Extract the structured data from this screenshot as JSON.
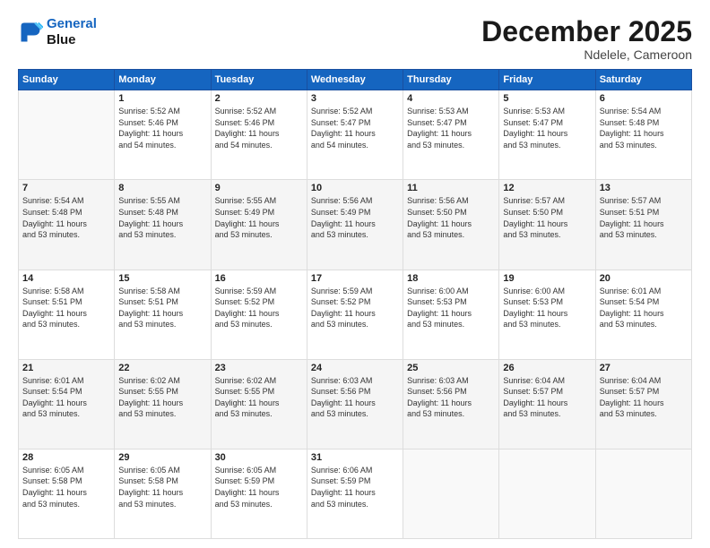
{
  "logo": {
    "line1": "General",
    "line2": "Blue"
  },
  "header": {
    "title": "December 2025",
    "subtitle": "Ndelele, Cameroon"
  },
  "weekdays": [
    "Sunday",
    "Monday",
    "Tuesday",
    "Wednesday",
    "Thursday",
    "Friday",
    "Saturday"
  ],
  "weeks": [
    [
      {
        "day": "",
        "info": ""
      },
      {
        "day": "1",
        "info": "Sunrise: 5:52 AM\nSunset: 5:46 PM\nDaylight: 11 hours\nand 54 minutes."
      },
      {
        "day": "2",
        "info": "Sunrise: 5:52 AM\nSunset: 5:46 PM\nDaylight: 11 hours\nand 54 minutes."
      },
      {
        "day": "3",
        "info": "Sunrise: 5:52 AM\nSunset: 5:47 PM\nDaylight: 11 hours\nand 54 minutes."
      },
      {
        "day": "4",
        "info": "Sunrise: 5:53 AM\nSunset: 5:47 PM\nDaylight: 11 hours\nand 53 minutes."
      },
      {
        "day": "5",
        "info": "Sunrise: 5:53 AM\nSunset: 5:47 PM\nDaylight: 11 hours\nand 53 minutes."
      },
      {
        "day": "6",
        "info": "Sunrise: 5:54 AM\nSunset: 5:48 PM\nDaylight: 11 hours\nand 53 minutes."
      }
    ],
    [
      {
        "day": "7",
        "info": "Sunrise: 5:54 AM\nSunset: 5:48 PM\nDaylight: 11 hours\nand 53 minutes."
      },
      {
        "day": "8",
        "info": "Sunrise: 5:55 AM\nSunset: 5:48 PM\nDaylight: 11 hours\nand 53 minutes."
      },
      {
        "day": "9",
        "info": "Sunrise: 5:55 AM\nSunset: 5:49 PM\nDaylight: 11 hours\nand 53 minutes."
      },
      {
        "day": "10",
        "info": "Sunrise: 5:56 AM\nSunset: 5:49 PM\nDaylight: 11 hours\nand 53 minutes."
      },
      {
        "day": "11",
        "info": "Sunrise: 5:56 AM\nSunset: 5:50 PM\nDaylight: 11 hours\nand 53 minutes."
      },
      {
        "day": "12",
        "info": "Sunrise: 5:57 AM\nSunset: 5:50 PM\nDaylight: 11 hours\nand 53 minutes."
      },
      {
        "day": "13",
        "info": "Sunrise: 5:57 AM\nSunset: 5:51 PM\nDaylight: 11 hours\nand 53 minutes."
      }
    ],
    [
      {
        "day": "14",
        "info": "Sunrise: 5:58 AM\nSunset: 5:51 PM\nDaylight: 11 hours\nand 53 minutes."
      },
      {
        "day": "15",
        "info": "Sunrise: 5:58 AM\nSunset: 5:51 PM\nDaylight: 11 hours\nand 53 minutes."
      },
      {
        "day": "16",
        "info": "Sunrise: 5:59 AM\nSunset: 5:52 PM\nDaylight: 11 hours\nand 53 minutes."
      },
      {
        "day": "17",
        "info": "Sunrise: 5:59 AM\nSunset: 5:52 PM\nDaylight: 11 hours\nand 53 minutes."
      },
      {
        "day": "18",
        "info": "Sunrise: 6:00 AM\nSunset: 5:53 PM\nDaylight: 11 hours\nand 53 minutes."
      },
      {
        "day": "19",
        "info": "Sunrise: 6:00 AM\nSunset: 5:53 PM\nDaylight: 11 hours\nand 53 minutes."
      },
      {
        "day": "20",
        "info": "Sunrise: 6:01 AM\nSunset: 5:54 PM\nDaylight: 11 hours\nand 53 minutes."
      }
    ],
    [
      {
        "day": "21",
        "info": "Sunrise: 6:01 AM\nSunset: 5:54 PM\nDaylight: 11 hours\nand 53 minutes."
      },
      {
        "day": "22",
        "info": "Sunrise: 6:02 AM\nSunset: 5:55 PM\nDaylight: 11 hours\nand 53 minutes."
      },
      {
        "day": "23",
        "info": "Sunrise: 6:02 AM\nSunset: 5:55 PM\nDaylight: 11 hours\nand 53 minutes."
      },
      {
        "day": "24",
        "info": "Sunrise: 6:03 AM\nSunset: 5:56 PM\nDaylight: 11 hours\nand 53 minutes."
      },
      {
        "day": "25",
        "info": "Sunrise: 6:03 AM\nSunset: 5:56 PM\nDaylight: 11 hours\nand 53 minutes."
      },
      {
        "day": "26",
        "info": "Sunrise: 6:04 AM\nSunset: 5:57 PM\nDaylight: 11 hours\nand 53 minutes."
      },
      {
        "day": "27",
        "info": "Sunrise: 6:04 AM\nSunset: 5:57 PM\nDaylight: 11 hours\nand 53 minutes."
      }
    ],
    [
      {
        "day": "28",
        "info": "Sunrise: 6:05 AM\nSunset: 5:58 PM\nDaylight: 11 hours\nand 53 minutes."
      },
      {
        "day": "29",
        "info": "Sunrise: 6:05 AM\nSunset: 5:58 PM\nDaylight: 11 hours\nand 53 minutes."
      },
      {
        "day": "30",
        "info": "Sunrise: 6:05 AM\nSunset: 5:59 PM\nDaylight: 11 hours\nand 53 minutes."
      },
      {
        "day": "31",
        "info": "Sunrise: 6:06 AM\nSunset: 5:59 PM\nDaylight: 11 hours\nand 53 minutes."
      },
      {
        "day": "",
        "info": ""
      },
      {
        "day": "",
        "info": ""
      },
      {
        "day": "",
        "info": ""
      }
    ]
  ]
}
